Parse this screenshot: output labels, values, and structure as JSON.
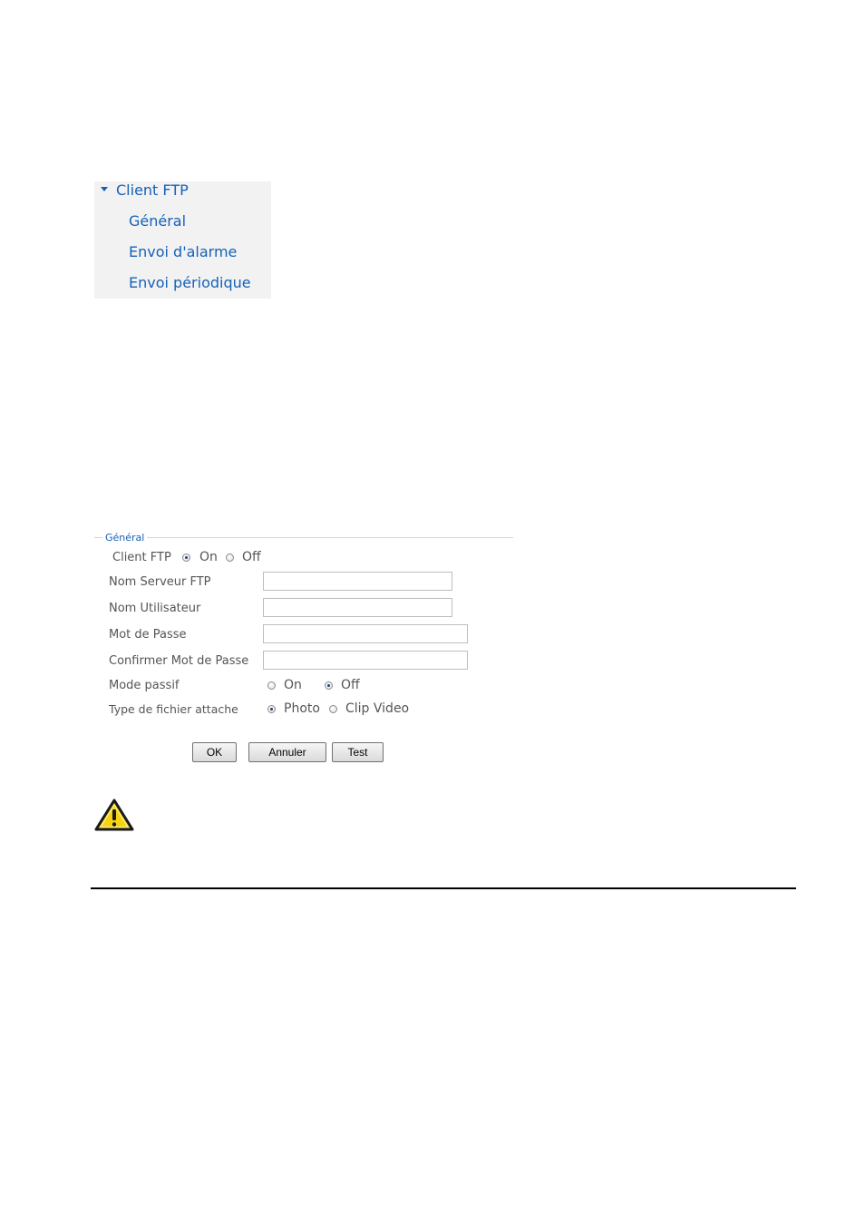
{
  "menu": {
    "header": "Client FTP",
    "items": [
      {
        "label": "Général"
      },
      {
        "label": "Envoi d'alarme"
      },
      {
        "label": "Envoi périodique"
      }
    ]
  },
  "form": {
    "legend": "Général",
    "client_ftp": {
      "label": "Client FTP",
      "on": "On",
      "off": "Off",
      "selected": "On"
    },
    "server": {
      "label": "Nom Serveur FTP",
      "value": ""
    },
    "user": {
      "label": "Nom Utilisateur",
      "value": ""
    },
    "password": {
      "label": "Mot de Passe",
      "value": ""
    },
    "confirm_password": {
      "label": "Confirmer Mot de Passe",
      "value": ""
    },
    "passive_mode": {
      "label": "Mode passif",
      "on": "On",
      "off": "Off",
      "selected": "Off"
    },
    "file_type": {
      "label": "Type de fichier attache",
      "photo": "Photo",
      "clip": "Clip Video",
      "selected": "Photo"
    },
    "buttons": {
      "ok": "OK",
      "cancel": "Annuler",
      "test": "Test"
    }
  },
  "colors": {
    "link": "#1561b8",
    "menu_bg": "#f2f2f2",
    "label": "#555555",
    "warning_fill": "#f5d40f"
  },
  "icons": {
    "warning": "warning-triangle-icon",
    "menu_toggle": "caret-down-icon"
  }
}
